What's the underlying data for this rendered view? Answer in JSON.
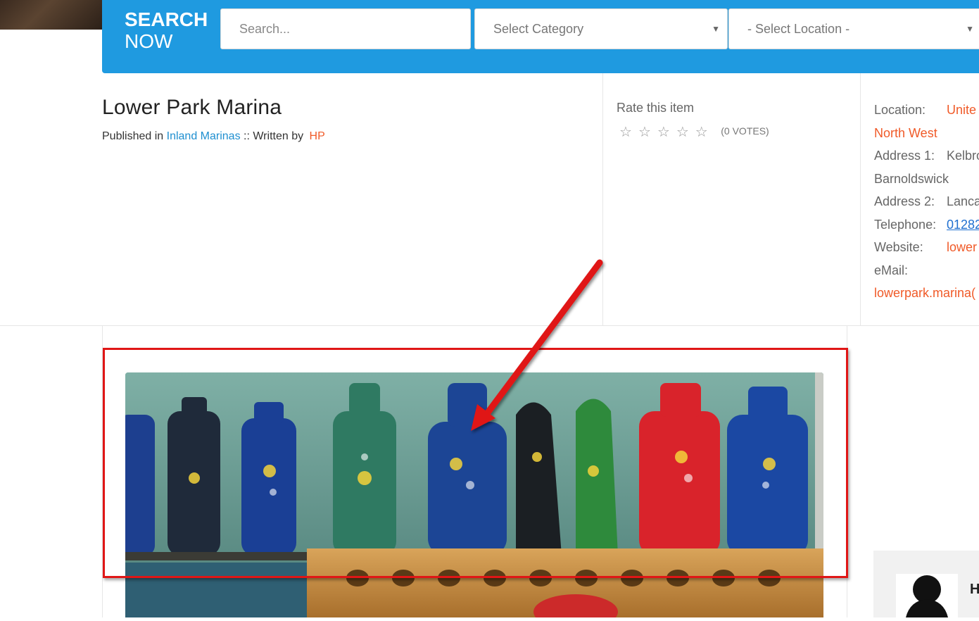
{
  "search": {
    "title_line1": "SEARCH",
    "title_line2": "NOW",
    "placeholder": "Search...",
    "category_selected": "Select Category",
    "location_selected": "- Select Location -"
  },
  "item": {
    "title": "Lower Park Marina",
    "published_in_label": "Published in",
    "category": "Inland Marinas",
    "written_by_label": ":: Written by",
    "author": "HP"
  },
  "rating": {
    "label": "Rate this item",
    "votes": "(0 VOTES)",
    "star_icon": "☆"
  },
  "details": {
    "location_label": "Location:",
    "location_value_1": "Unite",
    "location_value_2": "North West",
    "address1_label": "Address 1:",
    "address1_value_1": "Kelbro",
    "address1_value_2": "Barnoldswick",
    "address2_label": "Address 2:",
    "address2_value": "Lanca",
    "telephone_label": "Telephone:",
    "telephone_value": "01282",
    "website_label": "Website:",
    "website_value": "lower",
    "email_label": "eMail:",
    "email_value": "lowerpark.marina("
  },
  "sidebar": {
    "initial": "H"
  },
  "colors": {
    "brand_blue": "#1f9ae0",
    "link_orange": "#f05a28",
    "link_blue": "#1f8fd0",
    "annotation_red": "#e01616"
  }
}
